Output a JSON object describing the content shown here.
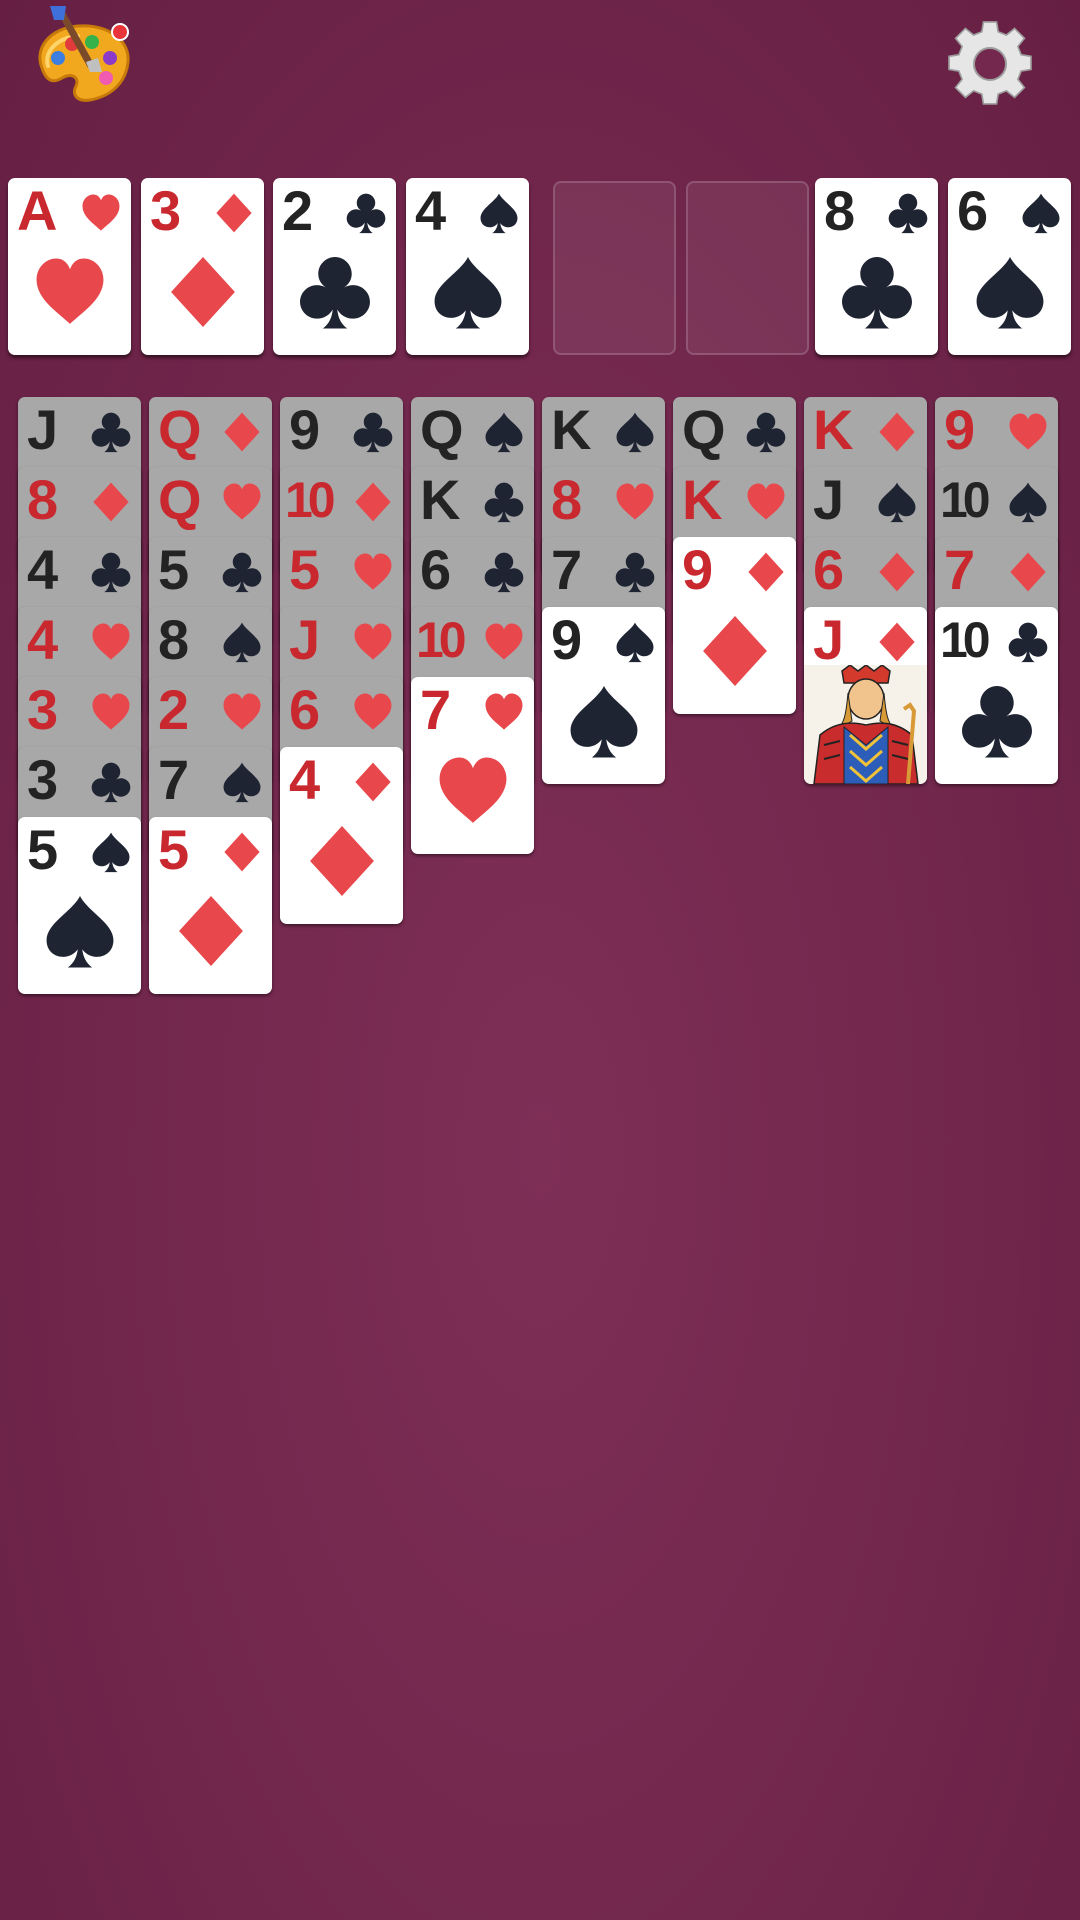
{
  "toolbar": {
    "theme_icon": "palette-icon",
    "settings_icon": "gear-icon"
  },
  "colors": {
    "table_felt": "#74284e",
    "red_suit": "#e8474c",
    "black_suit": "#1f2433",
    "card_face": "#ffffff",
    "card_covered": "#a8a8a8"
  },
  "top_row": [
    {
      "type": "card",
      "rank": "A",
      "suit": "hearts"
    },
    {
      "type": "card",
      "rank": "3",
      "suit": "diamonds"
    },
    {
      "type": "card",
      "rank": "2",
      "suit": "clubs"
    },
    {
      "type": "card",
      "rank": "4",
      "suit": "spades"
    },
    {
      "type": "empty"
    },
    {
      "type": "empty"
    },
    {
      "type": "card",
      "rank": "8",
      "suit": "clubs"
    },
    {
      "type": "card",
      "rank": "6",
      "suit": "spades"
    }
  ],
  "tableau": [
    [
      {
        "rank": "J",
        "suit": "clubs"
      },
      {
        "rank": "8",
        "suit": "diamonds"
      },
      {
        "rank": "4",
        "suit": "clubs"
      },
      {
        "rank": "4",
        "suit": "hearts"
      },
      {
        "rank": "3",
        "suit": "hearts"
      },
      {
        "rank": "3",
        "suit": "clubs"
      },
      {
        "rank": "5",
        "suit": "spades"
      }
    ],
    [
      {
        "rank": "Q",
        "suit": "diamonds"
      },
      {
        "rank": "Q",
        "suit": "hearts"
      },
      {
        "rank": "5",
        "suit": "clubs"
      },
      {
        "rank": "8",
        "suit": "spades"
      },
      {
        "rank": "2",
        "suit": "hearts"
      },
      {
        "rank": "7",
        "suit": "spades"
      },
      {
        "rank": "5",
        "suit": "diamonds"
      }
    ],
    [
      {
        "rank": "9",
        "suit": "clubs"
      },
      {
        "rank": "10",
        "suit": "diamonds"
      },
      {
        "rank": "5",
        "suit": "hearts"
      },
      {
        "rank": "J",
        "suit": "hearts"
      },
      {
        "rank": "6",
        "suit": "hearts"
      },
      {
        "rank": "4",
        "suit": "diamonds"
      }
    ],
    [
      {
        "rank": "Q",
        "suit": "spades"
      },
      {
        "rank": "K",
        "suit": "clubs"
      },
      {
        "rank": "6",
        "suit": "clubs"
      },
      {
        "rank": "10",
        "suit": "hearts"
      },
      {
        "rank": "7",
        "suit": "hearts"
      }
    ],
    [
      {
        "rank": "K",
        "suit": "spades"
      },
      {
        "rank": "8",
        "suit": "hearts"
      },
      {
        "rank": "7",
        "suit": "clubs"
      },
      {
        "rank": "9",
        "suit": "spades"
      }
    ],
    [
      {
        "rank": "Q",
        "suit": "clubs"
      },
      {
        "rank": "K",
        "suit": "hearts"
      },
      {
        "rank": "9",
        "suit": "diamonds"
      }
    ],
    [
      {
        "rank": "K",
        "suit": "diamonds"
      },
      {
        "rank": "J",
        "suit": "spades"
      },
      {
        "rank": "6",
        "suit": "diamonds"
      },
      {
        "rank": "J",
        "suit": "diamonds",
        "face": true
      }
    ],
    [
      {
        "rank": "9",
        "suit": "hearts"
      },
      {
        "rank": "10",
        "suit": "spades"
      },
      {
        "rank": "7",
        "suit": "diamonds"
      },
      {
        "rank": "10",
        "suit": "clubs"
      }
    ]
  ]
}
